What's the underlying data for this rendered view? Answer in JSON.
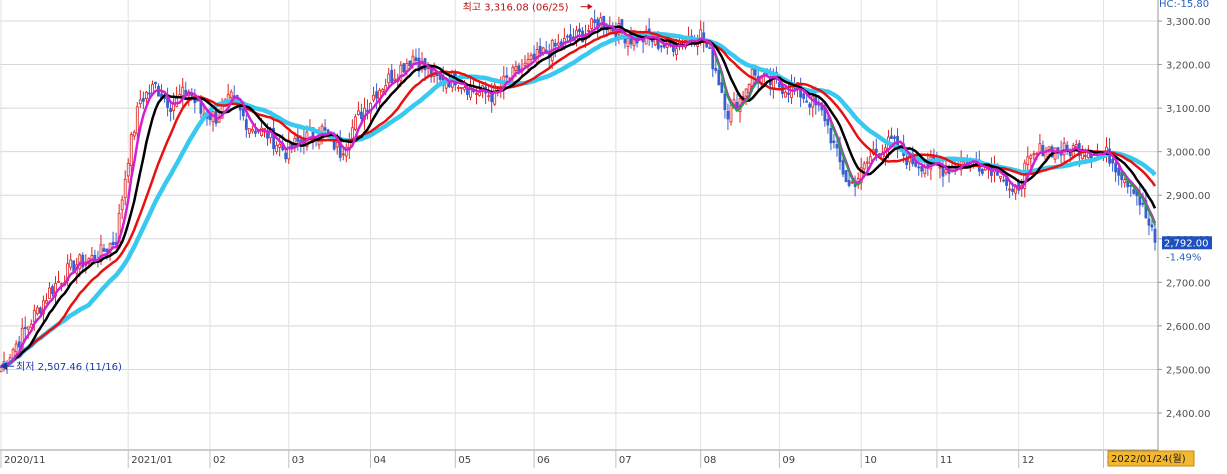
{
  "header": {
    "top_right_label": "HC:-15,80"
  },
  "chart_data": {
    "type": "candlestick",
    "title": "",
    "xlabel": "",
    "ylabel": "",
    "ylim": [
      2370,
      3330
    ],
    "grid": true,
    "colors": {
      "up": "#e02020",
      "down": "#3a5fcd",
      "ma5": "#d020d0",
      "ma10": "#000000",
      "ma20": "#e81010",
      "ma60": "#38c8f0",
      "ma_green": "#2f9a4a",
      "annotation": "#c01010",
      "low_annotation": "#1838a8",
      "current_price_bg": "#2050c0"
    },
    "y_ticks": [
      "2,400.00",
      "2,500.00",
      "2,600.00",
      "2,700.00",
      "2,800.00",
      "2,900.00",
      "3,000.00",
      "3,100.00",
      "3,200.00",
      "3,300.00"
    ],
    "y_tick_values": [
      2400,
      2500,
      2600,
      2700,
      2800,
      2900,
      3000,
      3100,
      3200,
      3300
    ],
    "x_ticks": [
      "2020/11",
      "2021/01",
      "02",
      "03",
      "04",
      "05",
      "06",
      "07",
      "08",
      "09",
      "10",
      "11",
      "12",
      "2022/01"
    ],
    "x_tick_index": [
      0,
      42,
      69,
      95,
      122,
      150,
      176,
      203,
      231,
      257,
      284,
      309,
      336,
      364
    ],
    "current_date_label": "2022/01/24(월)",
    "current_price_label": "2,792.00",
    "change_label": "-1.49%",
    "high_annotation": "최고 3,316.08 (06/25)",
    "low_annotation": "최저 2,507.46 (11/16)",
    "anchors": [
      {
        "i": 0,
        "v": 2505
      },
      {
        "i": 8,
        "v": 2590
      },
      {
        "i": 16,
        "v": 2680
      },
      {
        "i": 24,
        "v": 2740
      },
      {
        "i": 32,
        "v": 2760
      },
      {
        "i": 38,
        "v": 2800
      },
      {
        "i": 42,
        "v": 2990
      },
      {
        "i": 46,
        "v": 3120
      },
      {
        "i": 51,
        "v": 3150
      },
      {
        "i": 56,
        "v": 3110
      },
      {
        "i": 62,
        "v": 3140
      },
      {
        "i": 66,
        "v": 3090
      },
      {
        "i": 71,
        "v": 3080
      },
      {
        "i": 76,
        "v": 3120
      },
      {
        "i": 82,
        "v": 3060
      },
      {
        "i": 88,
        "v": 3040
      },
      {
        "i": 94,
        "v": 3000
      },
      {
        "i": 100,
        "v": 3030
      },
      {
        "i": 106,
        "v": 3050
      },
      {
        "i": 112,
        "v": 3000
      },
      {
        "i": 118,
        "v": 3080
      },
      {
        "i": 124,
        "v": 3140
      },
      {
        "i": 130,
        "v": 3180
      },
      {
        "i": 136,
        "v": 3220
      },
      {
        "i": 140,
        "v": 3190
      },
      {
        "i": 145,
        "v": 3160
      },
      {
        "i": 150,
        "v": 3170
      },
      {
        "i": 156,
        "v": 3140
      },
      {
        "i": 162,
        "v": 3130
      },
      {
        "i": 168,
        "v": 3170
      },
      {
        "i": 174,
        "v": 3200
      },
      {
        "i": 180,
        "v": 3230
      },
      {
        "i": 186,
        "v": 3250
      },
      {
        "i": 192,
        "v": 3270
      },
      {
        "i": 198,
        "v": 3300
      },
      {
        "i": 203,
        "v": 3280
      },
      {
        "i": 208,
        "v": 3260
      },
      {
        "i": 214,
        "v": 3260
      },
      {
        "i": 220,
        "v": 3240
      },
      {
        "i": 226,
        "v": 3260
      },
      {
        "i": 231,
        "v": 3270
      },
      {
        "i": 236,
        "v": 3190
      },
      {
        "i": 240,
        "v": 3090
      },
      {
        "i": 244,
        "v": 3120
      },
      {
        "i": 248,
        "v": 3180
      },
      {
        "i": 253,
        "v": 3160
      },
      {
        "i": 258,
        "v": 3150
      },
      {
        "i": 263,
        "v": 3140
      },
      {
        "i": 268,
        "v": 3110
      },
      {
        "i": 272,
        "v": 3080
      },
      {
        "i": 276,
        "v": 2990
      },
      {
        "i": 280,
        "v": 2920
      },
      {
        "i": 284,
        "v": 2950
      },
      {
        "i": 288,
        "v": 3000
      },
      {
        "i": 294,
        "v": 3020
      },
      {
        "i": 300,
        "v": 2980
      },
      {
        "i": 306,
        "v": 2970
      },
      {
        "i": 312,
        "v": 2960
      },
      {
        "i": 318,
        "v": 2980
      },
      {
        "i": 324,
        "v": 2970
      },
      {
        "i": 330,
        "v": 2960
      },
      {
        "i": 334,
        "v": 2890
      },
      {
        "i": 338,
        "v": 2960
      },
      {
        "i": 344,
        "v": 3010
      },
      {
        "i": 350,
        "v": 3000
      },
      {
        "i": 356,
        "v": 3010
      },
      {
        "i": 362,
        "v": 3000
      },
      {
        "i": 366,
        "v": 2990
      },
      {
        "i": 370,
        "v": 2950
      },
      {
        "i": 374,
        "v": 2920
      },
      {
        "i": 378,
        "v": 2850
      },
      {
        "i": 381,
        "v": 2792
      }
    ]
  }
}
